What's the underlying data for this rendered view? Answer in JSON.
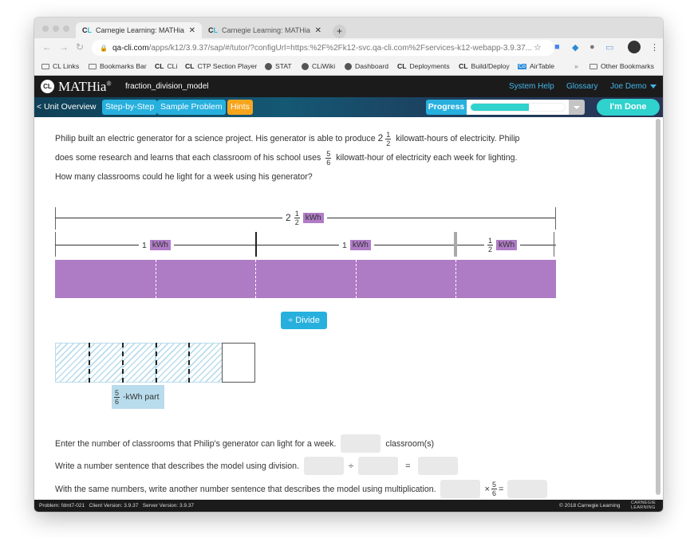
{
  "browser": {
    "tabs": [
      {
        "title": "Carnegie Learning: MATHia - fr",
        "active": true
      },
      {
        "title": "Carnegie Learning: MATHia - fr",
        "active": false
      }
    ],
    "url_host": "qa-cli.com",
    "url_path": "/apps/k12/3.9.37/sap/#/tutor/?configUrl=https:%2F%2Fk12-svc.qa-cli.com%2Fservices-k12-webapp-3.9.37...",
    "bookmarks": [
      {
        "label": "CL Links",
        "icon": "folder-icon"
      },
      {
        "label": "Bookmarks Bar",
        "icon": "folder-icon"
      },
      {
        "label": "CLi",
        "icon": "cl-icon"
      },
      {
        "label": "CTP Section Player",
        "icon": "cl-icon"
      },
      {
        "label": "STAT",
        "icon": "globe-icon"
      },
      {
        "label": "CLiWiki",
        "icon": "globe-icon"
      },
      {
        "label": "Dashboard",
        "icon": "globe-icon"
      },
      {
        "label": "Deployments",
        "icon": "cl-icon"
      },
      {
        "label": "Build/Deploy",
        "icon": "cl-icon"
      },
      {
        "label": "AirTable",
        "icon": "airtable-icon"
      }
    ],
    "overflow": "»",
    "other_bookmarks": "Other Bookmarks"
  },
  "app": {
    "logo_mark": "CL",
    "logo_text": "MATHia",
    "logo_reg": "®",
    "model_name": "fraction_division_model",
    "links": {
      "help": "System Help",
      "glossary": "Glossary",
      "user": "Joe Demo"
    },
    "nav": {
      "unit_overview": "< Unit Overview",
      "step_by_step": "Step-by-Step",
      "sample_problem": "Sample Problem",
      "hints": "Hints"
    },
    "progress": {
      "label": "Progress",
      "percent": 62
    },
    "done": "I'm Done"
  },
  "problem": {
    "part1": "Philip built an electric generator for a science project. His generator is able to produce",
    "produce_whole": "2",
    "produce_num": "1",
    "produce_den": "2",
    "part2": "kilowatt-hours of electricity. Philip",
    "part3": "does some research and learns that each classroom of his school uses",
    "use_num": "5",
    "use_den": "6",
    "part4": "kilowatt-hour of electricity each week for lighting.",
    "part5": "How many classrooms could he light for a week using his generator?"
  },
  "model": {
    "total": {
      "whole": "2",
      "num": "1",
      "den": "2",
      "unit": "kWh"
    },
    "segments": [
      {
        "whole": "1",
        "unit": "kWh"
      },
      {
        "whole": "1",
        "unit": "kWh"
      },
      {
        "num": "1",
        "den": "2",
        "unit": "kWh"
      }
    ],
    "bar_parts": 5,
    "bar_color": "#ae7bc5"
  },
  "divide_button": {
    "icon": "÷",
    "label": "Divide"
  },
  "part_model": {
    "parts_total": 6,
    "parts_shaded": 5,
    "label_num": "5",
    "label_den": "6",
    "label_text": "-kWh part"
  },
  "questions": {
    "q1": {
      "text": "Enter the number of classrooms that Philip's generator can light for a week.",
      "suffix": "classroom(s)",
      "value": ""
    },
    "q2": {
      "text": "Write a number sentence that describes the model using division.",
      "divide": "÷",
      "equals": "=",
      "values": [
        "",
        "",
        ""
      ]
    },
    "q3": {
      "text": "With the same numbers, write another number sentence that describes the model using multiplication.",
      "times": "×",
      "num": "5",
      "den": "6",
      "equals": "=",
      "values": [
        "",
        ""
      ]
    }
  },
  "footer": {
    "problem": "Problem: fdmt7-021",
    "client": "Client Version: 3.9.37",
    "server": "Server Version: 3.9.37",
    "copyright": "© 2018 Carnegie Learning",
    "brand_line1": "CARNEGIE",
    "brand_line2": "LEARNING"
  },
  "colors": {
    "accent_blue": "#27b0de",
    "hints_orange": "#f7a51c",
    "teal": "#2fd2cc",
    "purple": "#ae7bc5",
    "hatch_blue": "#b9dcec"
  }
}
